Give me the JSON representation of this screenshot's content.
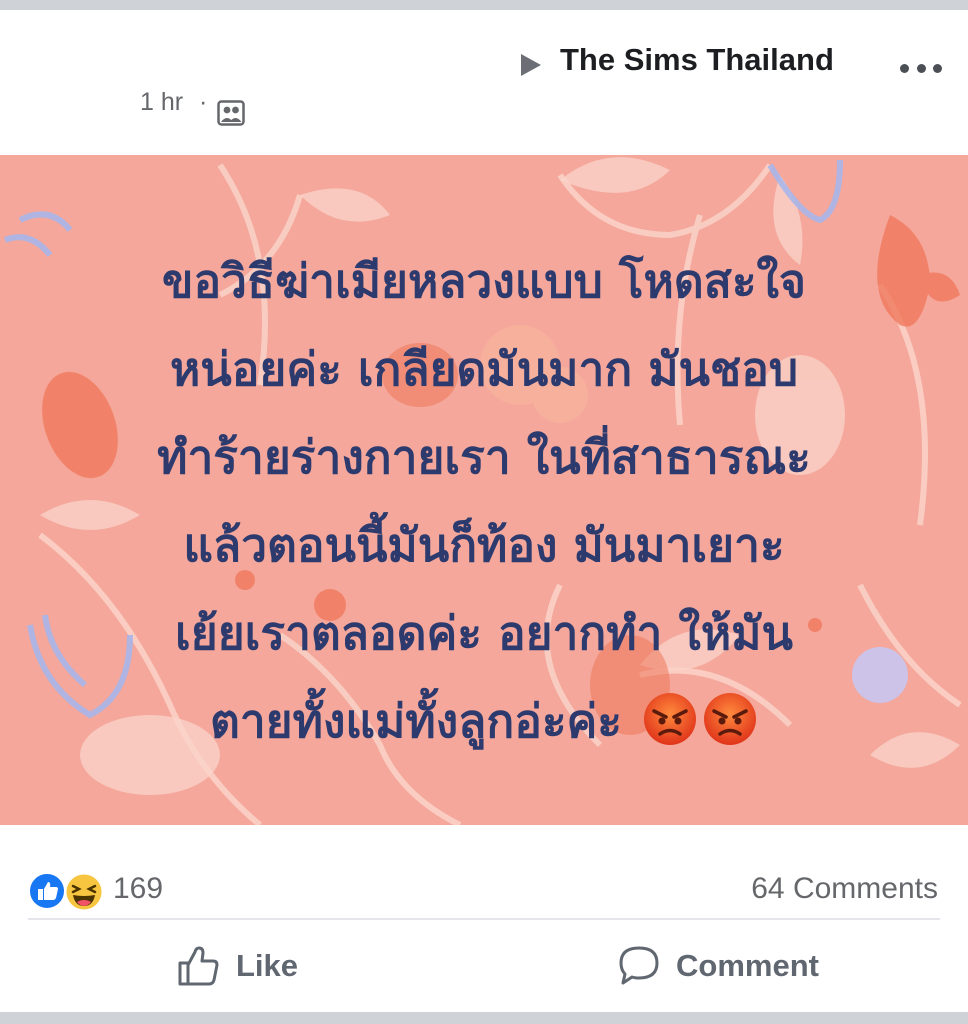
{
  "post": {
    "group_name": "The Sims Thailand",
    "timestamp": "1 hr",
    "separator": "·",
    "audience_icon": "group-audience-icon",
    "more_icon": "more-options-icon"
  },
  "background_post": {
    "background_color": "#f4a79a",
    "text_color": "#2c3a6e",
    "lines": [
      "ขอวิธีฆ่าเมียหลวงแบบ โหดสะใจ",
      "หน่อยค่ะ เกลียดมันมาก มันชอบ",
      "ทำร้ายร่างกายเรา ในที่สาธารณะ",
      "แล้วตอนนี้มันก็ท้อง มันมาเยาะ",
      "เย้ยเราตลอดค่ะ อยากทำ ให้มัน",
      "ตายทั้งแม่ทั้งลูกอ่ะค่ะ"
    ],
    "trailing_emoji": [
      "angry-face-emoji",
      "angry-face-emoji"
    ]
  },
  "reactions": {
    "icons": [
      "like-reaction-icon",
      "haha-reaction-icon"
    ],
    "count": "169",
    "comments": "64 Comments"
  },
  "actions": {
    "like_label": "Like",
    "comment_label": "Comment"
  }
}
